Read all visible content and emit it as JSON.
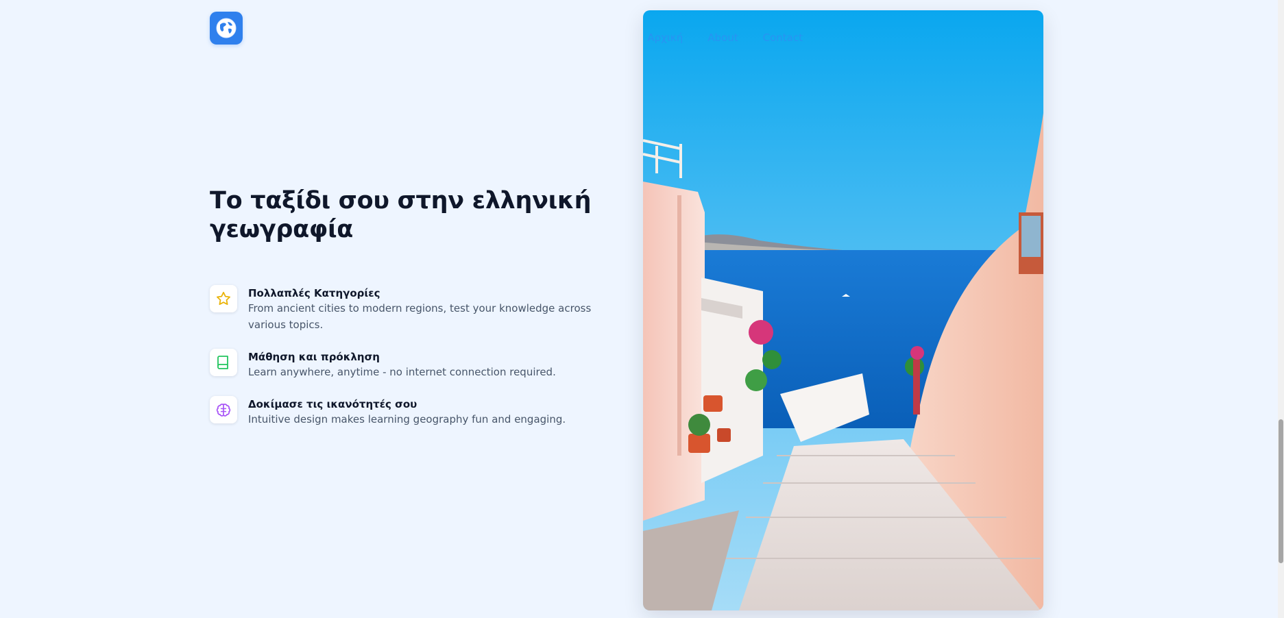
{
  "brand": {
    "logo_icon": "globe-icon",
    "accent": "#2f80ed"
  },
  "nav": {
    "items": [
      {
        "label": "Αρχική"
      },
      {
        "label": "About"
      },
      {
        "label": "Contact"
      }
    ]
  },
  "hero": {
    "headline_line1": "Το ταξίδι σου στην ελληνική",
    "headline_line2": "γεωγραφία"
  },
  "features": [
    {
      "icon": "star-icon",
      "icon_color": "#eab308",
      "title": "Πολλαπλές Κατηγορίες",
      "description": "From ancient cities to modern regions, test your knowledge across various topics."
    },
    {
      "icon": "book-icon",
      "icon_color": "#22c55e",
      "title": "Μάθηση και πρόκληση",
      "description": "Learn anywhere, anytime - no internet connection required."
    },
    {
      "icon": "brain-icon",
      "icon_color": "#a855f7",
      "title": "Δοκίμασε τις ικανότητές σου",
      "description": "Intuitive design makes learning geography fun and engaging."
    }
  ],
  "image": {
    "subject": "santorini-stairs-photo"
  }
}
